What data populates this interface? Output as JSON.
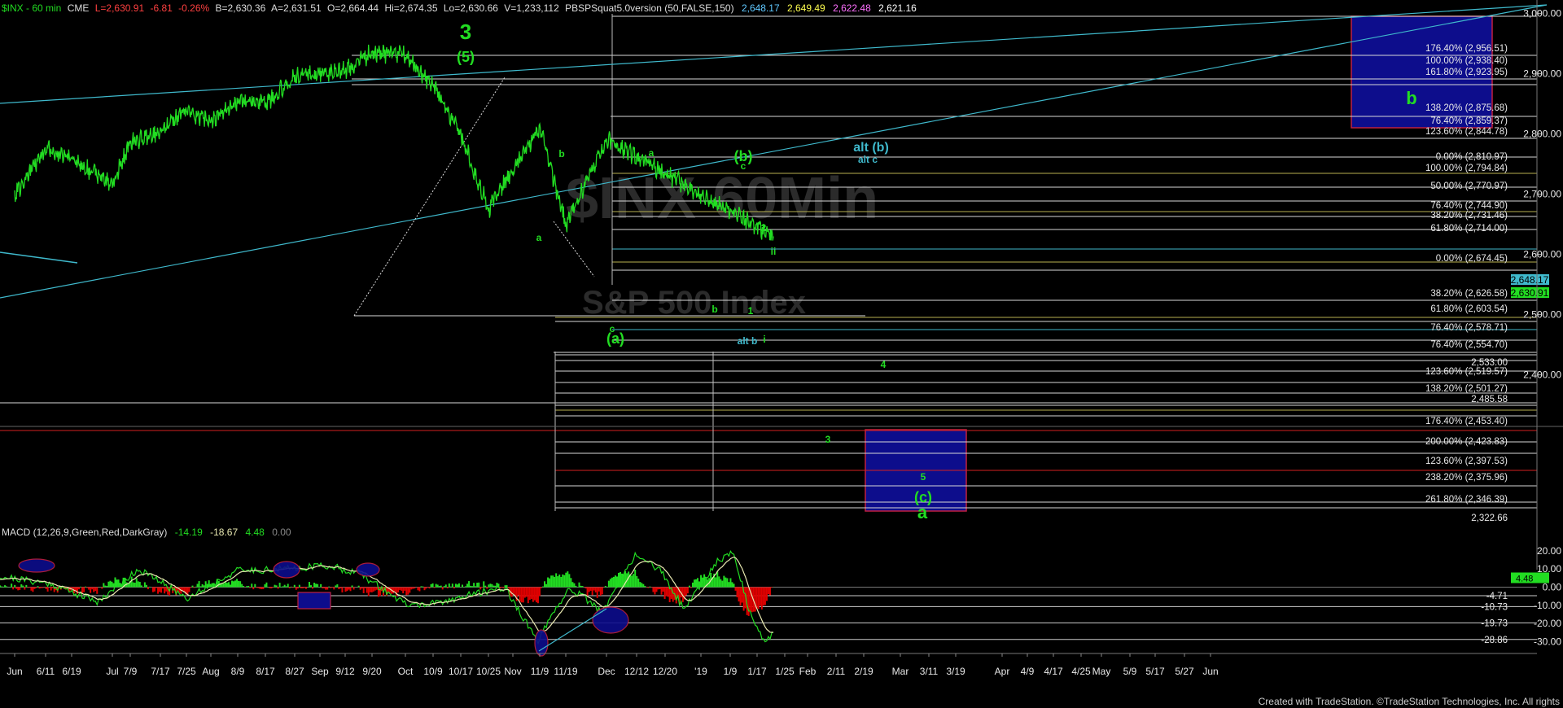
{
  "header": {
    "symbol": "$INX - 60 min",
    "exchange": "CME",
    "last": "L=2,630.91",
    "change": "-6.81",
    "change_pct": "-0.26%",
    "bid": "B=2,630.36",
    "ask": "A=2,631.51",
    "open": "O=2,664.44",
    "high": "Hi=2,674.35",
    "low": "Lo=2,630.66",
    "volume": "V=1,233,112",
    "indicator": "PBSPSquat5.0version (50,FALSE,150)",
    "indicator_values": [
      "2,648.17",
      "2,649.49",
      "2,622.48",
      "2,621.16"
    ]
  },
  "watermark": {
    "line1": "$INX 60Min",
    "line2": "S&P 500 Index"
  },
  "footer": "Created with TradeStation. ©TradeStation Technologies, Inc. All rights",
  "colors": {
    "background": "#000000",
    "price": "#22dd22",
    "cyan_lines": "#3fb9cc",
    "white_lines": "#d8d8d8",
    "olive_lines": "#b8b050",
    "red_lines": "#d42020",
    "box": "#0d0d8c",
    "macd_line": "#22dd22",
    "macd_signal": "#e8e8b0",
    "hist_pos": "#22dd22",
    "hist_neg": "#e00000"
  },
  "chart_data": [
    {
      "type": "line",
      "title": "$INX - 60 min",
      "ylim": [
        2300,
        3020
      ],
      "y_ticks": [
        3000,
        2900,
        2800,
        2700,
        2600,
        2500,
        2400
      ],
      "x_categories": [
        "Jun",
        "6/11",
        "6/19",
        "Jul",
        "7/9",
        "7/17",
        "7/25",
        "Aug",
        "8/9",
        "8/17",
        "8/27",
        "Sep",
        "9/12",
        "9/20",
        "Oct",
        "10/9",
        "10/17",
        "10/25",
        "Nov",
        "11/9",
        "11/19",
        "Dec",
        "12/12",
        "12/20",
        "'19",
        "1/9",
        "1/17",
        "1/25",
        "Feb",
        "2/11",
        "2/19",
        "Mar",
        "3/11",
        "3/19",
        "Apr",
        "4/9",
        "4/17",
        "4/25",
        "May",
        "5/9",
        "5/17",
        "5/27",
        "Jun"
      ],
      "series": [
        {
          "points": [
            [
              "Jun",
              2700
            ],
            [
              "6/11",
              2775
            ],
            [
              "6/19",
              2760
            ],
            [
              "Jul",
              2715
            ],
            [
              "7/9",
              2785
            ],
            [
              "7/17",
              2805
            ],
            [
              "7/25",
              2840
            ],
            [
              "Aug",
              2820
            ],
            [
              "8/9",
              2855
            ],
            [
              "8/17",
              2850
            ],
            [
              "8/27",
              2895
            ],
            [
              "Sep",
              2900
            ],
            [
              "9/12",
              2905
            ],
            [
              "9/20",
              2935
            ],
            [
              "Oct",
              2930
            ],
            [
              "10/9",
              2880
            ],
            [
              "10/17",
              2800
            ],
            [
              "10/25",
              2675
            ],
            [
              "Nov",
              2740
            ],
            [
              "11/9",
              2810
            ],
            [
              "11/19",
              2650
            ],
            [
              "Dec",
              2790
            ],
            [
              "12/12",
              2630
            ]
          ]
        }
      ],
      "right_scale_labels": [
        "176.40% (2,956.51)",
        "100.00% (2,938.40)",
        "161.80% (2,923.95)",
        "138.20% (2,875.68)",
        "76.40% (2,859.37)",
        "123.60% (2,844.78)",
        "0.00% (2,810.97)",
        "100.00% (2,794.84)",
        "50.00% (2,770.97)",
        "76.40% (2,744.90)",
        "38.20% (2,731.46)",
        "61.80% (2,714.00)",
        "0.00% (2,674.45)",
        "38.20% (2,626.58)",
        "61.80% (2,603.54)",
        "76.40% (2,578.71)",
        "76.40% (2,554.70)",
        "2,533.00",
        "123.60% (2,519.57)",
        "138.20% (2,501.27)",
        "2,485.58",
        "176.40% (2,453.40)",
        "200.00% (2,423.83)",
        "123.60% (2,397.53)",
        "238.20% (2,375.96)",
        "261.80% (2,346.39)",
        "2,322.66"
      ],
      "price_tags": [
        "2,648.17",
        "2,630.91"
      ],
      "wave_labels": [
        "3",
        "(5)",
        "a",
        "b",
        "c",
        "(a)",
        "a",
        "b",
        "c",
        "(b)",
        "1",
        "2",
        "i",
        "ii",
        "alt b",
        "alt (b)",
        "alt c",
        "3",
        "4",
        "5",
        "(c)",
        "a",
        "b"
      ],
      "boxes": [
        "upper-right target (b)",
        "lower target (c)"
      ]
    },
    {
      "type": "bar",
      "title": "MACD (12,26,9,Green,Red,DarkGray)",
      "values_shown": [
        "-14.19",
        "-18.67",
        "4.48",
        "0.00"
      ],
      "ylim": [
        -33,
        24
      ],
      "y_ticks": [
        20,
        10,
        0,
        -10,
        -20,
        -30
      ],
      "level_lines": [
        "-4.71",
        "-10.73",
        "-19.73",
        "-28.86"
      ],
      "current_tags": [
        "4.48"
      ]
    }
  ]
}
